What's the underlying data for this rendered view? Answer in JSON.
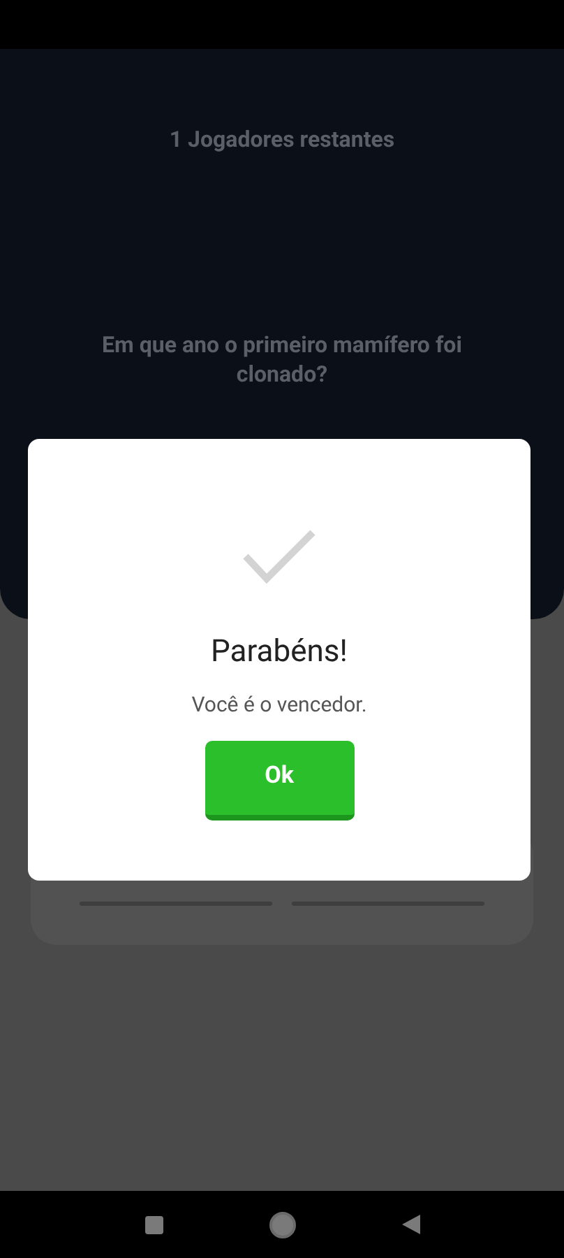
{
  "game": {
    "players_remaining": "1 Jogadores restantes",
    "question": "Em que ano o primeiro mamífero foi clonado?"
  },
  "dialog": {
    "title": "Parabéns!",
    "message": "Você é o vencedor.",
    "button": "Ok"
  }
}
